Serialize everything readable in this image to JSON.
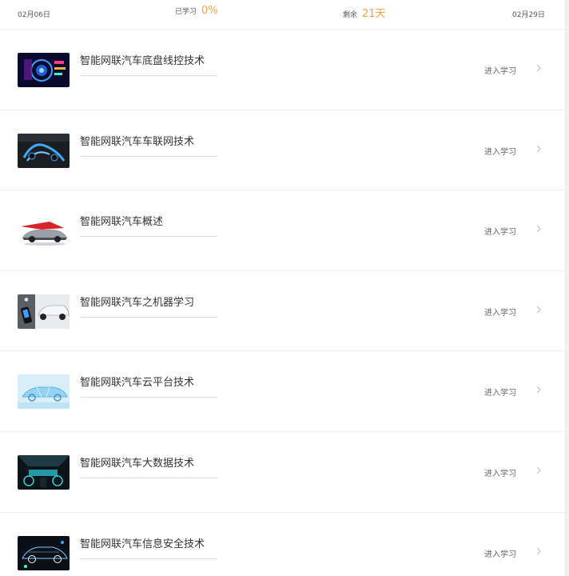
{
  "header": {
    "start_date": "02月06日",
    "studied_label": "已学习",
    "studied_value": "0%",
    "remain_label": "剩余",
    "remain_value": "21天",
    "end_date": "02月29日"
  },
  "courses": [
    {
      "title": "智能网联汽车底盘线控技术",
      "action": "进入学习",
      "thumb_icon": "dashboard-tech-thumbnail"
    },
    {
      "title": "智能网联汽车车联网技术",
      "action": "进入学习",
      "thumb_icon": "network-car-thumbnail"
    },
    {
      "title": "智能网联汽车概述",
      "action": "进入学习",
      "thumb_icon": "sports-car-thumbnail"
    },
    {
      "title": "智能网联汽车之机器学习",
      "action": "进入学习",
      "thumb_icon": "phone-car-thumbnail"
    },
    {
      "title": "智能网联汽车云平台技术",
      "action": "进入学习",
      "thumb_icon": "xray-car-thumbnail"
    },
    {
      "title": "智能网联汽车大数据技术",
      "action": "进入学习",
      "thumb_icon": "car-interior-thumbnail"
    },
    {
      "title": "智能网联汽车信息安全技术",
      "action": "进入学习",
      "thumb_icon": "wireframe-car-thumbnail"
    }
  ],
  "colors": {
    "accent_orange": "#f0a040",
    "text_dark": "#333333",
    "text_muted": "#666666",
    "divider": "#ececec"
  }
}
